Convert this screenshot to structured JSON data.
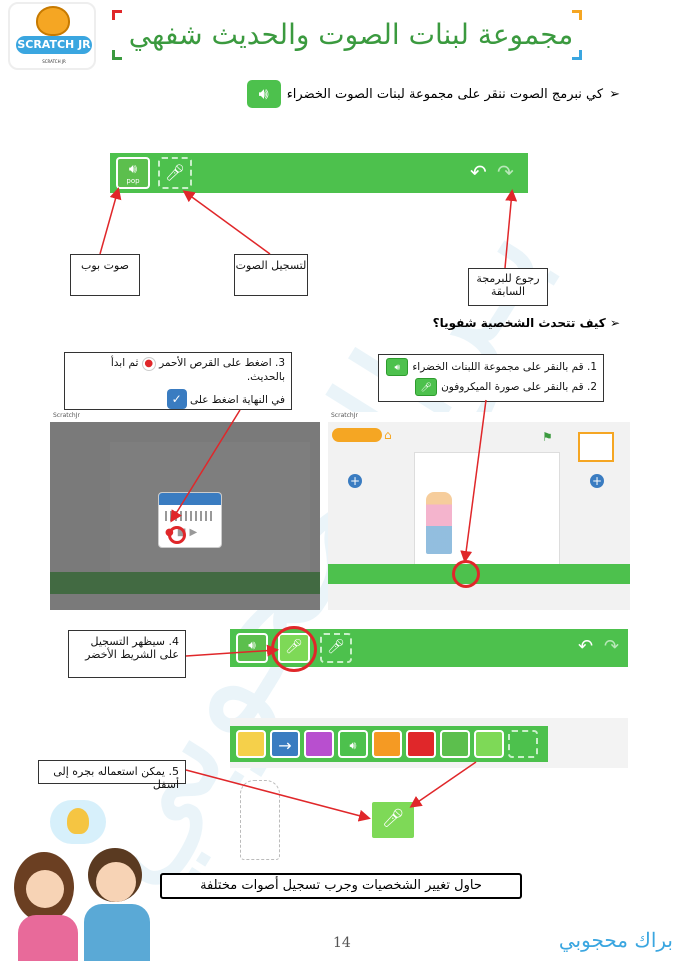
{
  "header": {
    "logo_text": "SCRATCH JR",
    "logo_url": "SCRATCH JR",
    "title": "مجموعة لبنات الصوت والحديث شفهي"
  },
  "intro": {
    "text": "كي نبرمج الصوت ننقر على مجموعة لبنات الصوت الخضراء"
  },
  "toolbar_top": {
    "pop_label": "pop",
    "callouts": {
      "pop": "صوت بوب",
      "record": "لتسجيل الصوت",
      "undo": "رجوع للبرمجة السابقة"
    }
  },
  "section2": {
    "heading": "كيف تتحدث الشخصية شفويا؟",
    "step1": "قم بالنقر على مجموعة اللبنات الخضراء",
    "step1_num": "1.",
    "step2": "قم بالنقر على صورة الميكروفون",
    "step2_num": "2.",
    "step3_a": "اضغط على القرص الأحمر",
    "step3_b": "ثم ابدأ بالحديث.",
    "step3_c": "في النهاية  اضغط على",
    "step3_num": "3.",
    "step4": "سيظهر التسجيل على الشريط الأخضر",
    "step4_num": "4.",
    "step5": "يمكن استعماله بجره إلى أسفل",
    "step5_num": "5.",
    "app_title_left": "ScratchJr",
    "app_title_right": "ScratchJr"
  },
  "footer": {
    "task": "حاول تغيير الشخصيات وجرب تسجيل أصوات مختلفة",
    "page_number": "14",
    "signature": "براك محجوبي"
  },
  "colors": {
    "title_green": "#3b9a3f",
    "toolbar_green": "#4dc14d",
    "block_green": "#7ed957",
    "highlight_red": "#e0272a"
  }
}
